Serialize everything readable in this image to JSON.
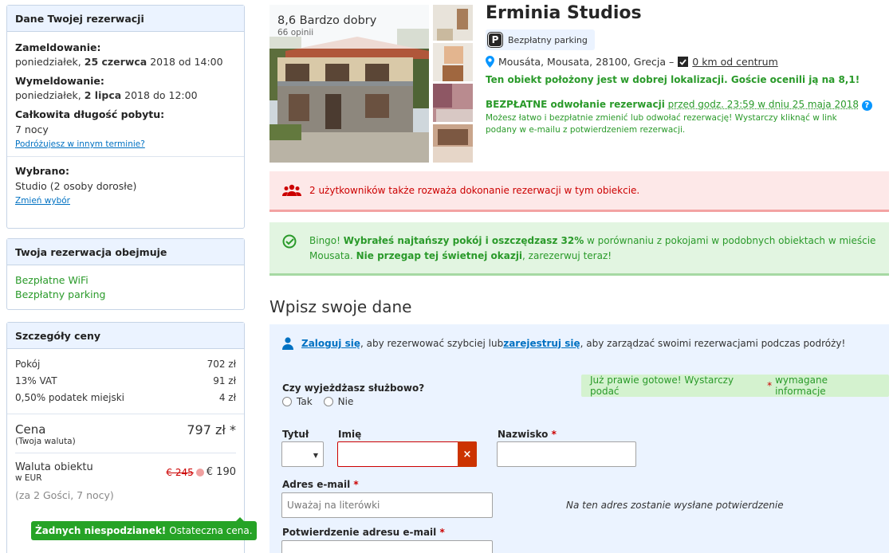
{
  "left": {
    "reservation": {
      "title": "Dane Twojej rezerwacji",
      "checkin_label": "Zameldowanie:",
      "checkin_day": "poniedziałek,",
      "checkin_date": "25 czerwca",
      "checkin_rest": "2018 od 14:00",
      "checkout_label": "Wymeldowanie:",
      "checkout_day": "poniedziałek,",
      "checkout_date": "2 lipca",
      "checkout_rest": "2018 do 12:00",
      "length_label": "Całkowita długość pobytu:",
      "length_value": "7 nocy",
      "other_date_link": "Podróżujesz w innym terminie?",
      "selected_label": "Wybrano:",
      "selected_value": "Studio (2 osoby dorosłe)",
      "change_link": "Zmień wybór"
    },
    "includes": {
      "title": "Twoja rezerwacja obejmuje",
      "items": [
        "Bezpłatne WiFi",
        "Bezpłatny parking"
      ]
    },
    "price": {
      "title": "Szczegóły ceny",
      "rows": [
        {
          "label": "Pokój",
          "value": "702 zł"
        },
        {
          "label": "13% VAT",
          "value": "91 zł"
        },
        {
          "label": "0,50% podatek miejski",
          "value": "4 zł"
        }
      ],
      "total_label": "Cena",
      "total_value": "797 zł *",
      "total_sub": "(Twoja waluta)",
      "prop_label": "Waluta obiektu",
      "prop_sub": "w EUR",
      "prop_old": "€ 245",
      "prop_new": "€ 190",
      "guests": "(za 2 Gości, 7 nocy)",
      "no_surprise_bold": "Żadnych niespodzianek!",
      "no_surprise_rest": "Ostateczna cena."
    }
  },
  "hotel": {
    "score_text": "8,6 Bardzo dobry",
    "reviews": "66 opinii",
    "name": "Erminia Studios",
    "parking_badge": "Bezpłatny parking",
    "parking_icon": "P",
    "address": "Mousáta, Mousata, 28100, Grecja –",
    "distance": "0 km od centrum",
    "location_note": "Ten obiekt położony jest w dobrej lokalizacji. Goście ocenili ją na 8,1!",
    "cancel_bold": "BEZPŁATNE odwołanie rezerwacji",
    "cancel_rest": "przed godz. 23:59 w dniu 25 maja 2018",
    "cancel_desc": "Możesz łatwo i bezpłatnie zmienić lub odwołać rezerwację! Wystarczy kliknąć w link podany w e-mailu z potwierdzeniem rezerwacji."
  },
  "alerts": {
    "red": "2 użytkowników także rozważa dokonanie rezerwacji w tym obiekcie.",
    "green_p1": "Bingo! ",
    "green_b1": "Wybrałeś najtańszy pokój i oszczędzasz 32%",
    "green_p2": " w porównaniu z pokojami w podobnych obiektach w mieście Mousata. ",
    "green_b2": "Nie przegap tej świetnej okazji",
    "green_p3": ", zarezerwuj teraz!"
  },
  "form": {
    "title": "Wpisz swoje dane",
    "login_link": "Zaloguj się",
    "login_mid": ", aby rezerwować szybciej lub ",
    "register_link": "zarejestruj się",
    "login_end": ", aby zarządzać swoimi rezerwacjami podczas podróży!",
    "business_label": "Czy wyjeżdżasz służbowo?",
    "opt_yes": "Tak",
    "opt_no": "Nie",
    "almost_pre": "Już prawie gotowe! Wystarczy podać ",
    "almost_star": "*",
    "almost_post": " wymagane informacje",
    "title_label": "Tytuł",
    "first_label": "Imię",
    "last_label": "Nazwisko",
    "star": "*",
    "email_label": "Adres e-mail",
    "email_placeholder": "Uważaj na literówki",
    "email_note": "Na ten adres zostanie wysłane potwierdzenie",
    "confirm_label": "Potwierdzenie adresu e-mail"
  },
  "colors": {
    "accent": "#0071c2",
    "green": "#2a9a2a",
    "red": "#cc0000",
    "panel_head": "#ebf3ff"
  }
}
